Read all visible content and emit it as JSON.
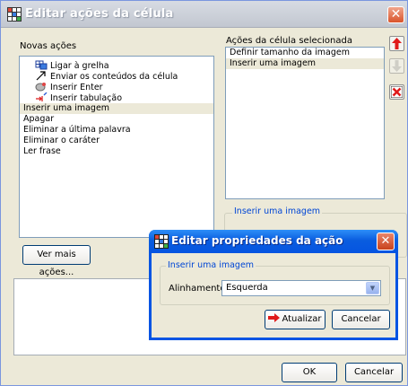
{
  "main_window": {
    "title": "Editar ações da célula",
    "close_glyph": "✕",
    "new_actions_label": "Novas ações",
    "new_actions": [
      {
        "label": "Ligar à grelha",
        "icon": "grid-link-icon",
        "selected": false
      },
      {
        "label": "Enviar os conteúdos da célula",
        "icon": "send-arrow-icon",
        "selected": false
      },
      {
        "label": "Inserir Enter",
        "icon": "enter-key-icon",
        "selected": false
      },
      {
        "label": "Inserir tabulação",
        "icon": "tab-key-icon",
        "selected": false
      },
      {
        "label": "Inserir uma imagem",
        "icon": "",
        "selected": true
      },
      {
        "label": "Apagar",
        "icon": "",
        "selected": false
      },
      {
        "label": "Eliminar a última palavra",
        "icon": "",
        "selected": false
      },
      {
        "label": "Eliminar o caráter",
        "icon": "",
        "selected": false
      },
      {
        "label": "Ler frase",
        "icon": "",
        "selected": false
      }
    ],
    "cell_actions_label": "Ações da célula selecionada",
    "cell_actions": [
      {
        "label": "Definir tamanho da imagem",
        "selected": false
      },
      {
        "label": "Inserir uma imagem",
        "selected": true
      }
    ],
    "move_up_icon": "arrow-up-icon",
    "move_down_icon": "arrow-down-icon",
    "delete_icon": "delete-x-icon",
    "group_label": "Inserir uma imagem",
    "more_actions_button": "Ver mais ações...",
    "ok_button": "OK",
    "cancel_button": "Cancelar"
  },
  "child_dialog": {
    "title": "Editar propriedades da ação",
    "close_glyph": "✕",
    "group_label": "Inserir uma imagem",
    "alignment_label": "Alinhamento",
    "alignment_value": "Esquerda",
    "update_button": "Atualizar",
    "cancel_button": "Cancelar"
  },
  "colors": {
    "selection": "#ece9d8",
    "dialog_title": "#0a5ddf",
    "accent_red": "#e01a1a"
  }
}
